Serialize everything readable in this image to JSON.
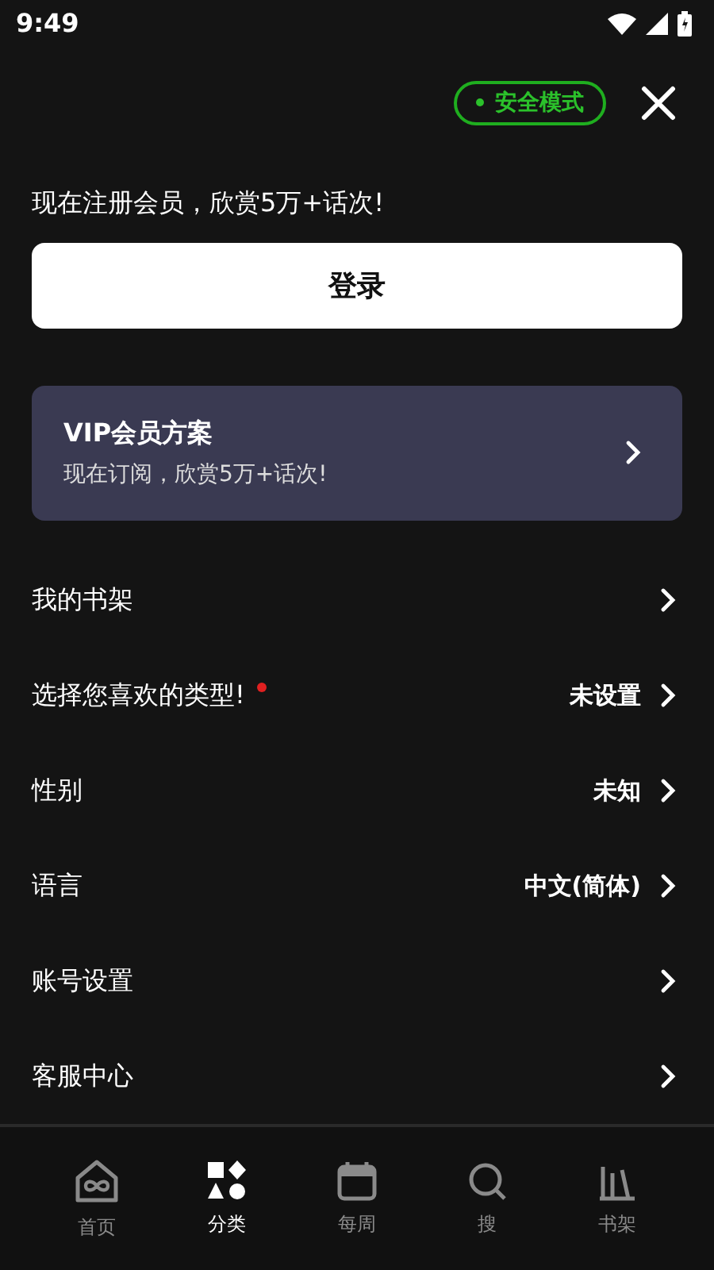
{
  "status_bar": {
    "time": "9:49"
  },
  "header": {
    "safe_mode": {
      "label": "安全模式",
      "on": true
    }
  },
  "promo": "现在注册会员，欣赏5万+话次!",
  "login_button": "登录",
  "vip_card": {
    "title": "VIP会员方案",
    "subtitle": "现在订阅，欣赏5万+话次!"
  },
  "menu": [
    {
      "label": "我的书架",
      "alert": false
    },
    {
      "label": "选择您喜欢的类型!",
      "alert": true,
      "value": "未设置"
    },
    {
      "label": "性别",
      "alert": false,
      "value": "未知"
    },
    {
      "label": "语言",
      "alert": false,
      "value": "中文(简体)"
    },
    {
      "label": "账号设置",
      "alert": false
    },
    {
      "label": "客服中心",
      "alert": false
    }
  ],
  "bottom_nav": [
    {
      "label": "首页",
      "kind": "home",
      "selected": false
    },
    {
      "label": "分类",
      "kind": "category",
      "selected": true
    },
    {
      "label": "每周",
      "kind": "calendar",
      "selected": false
    },
    {
      "label": "搜",
      "kind": "search",
      "selected": false
    },
    {
      "label": "书架",
      "kind": "shelf",
      "selected": false
    }
  ]
}
